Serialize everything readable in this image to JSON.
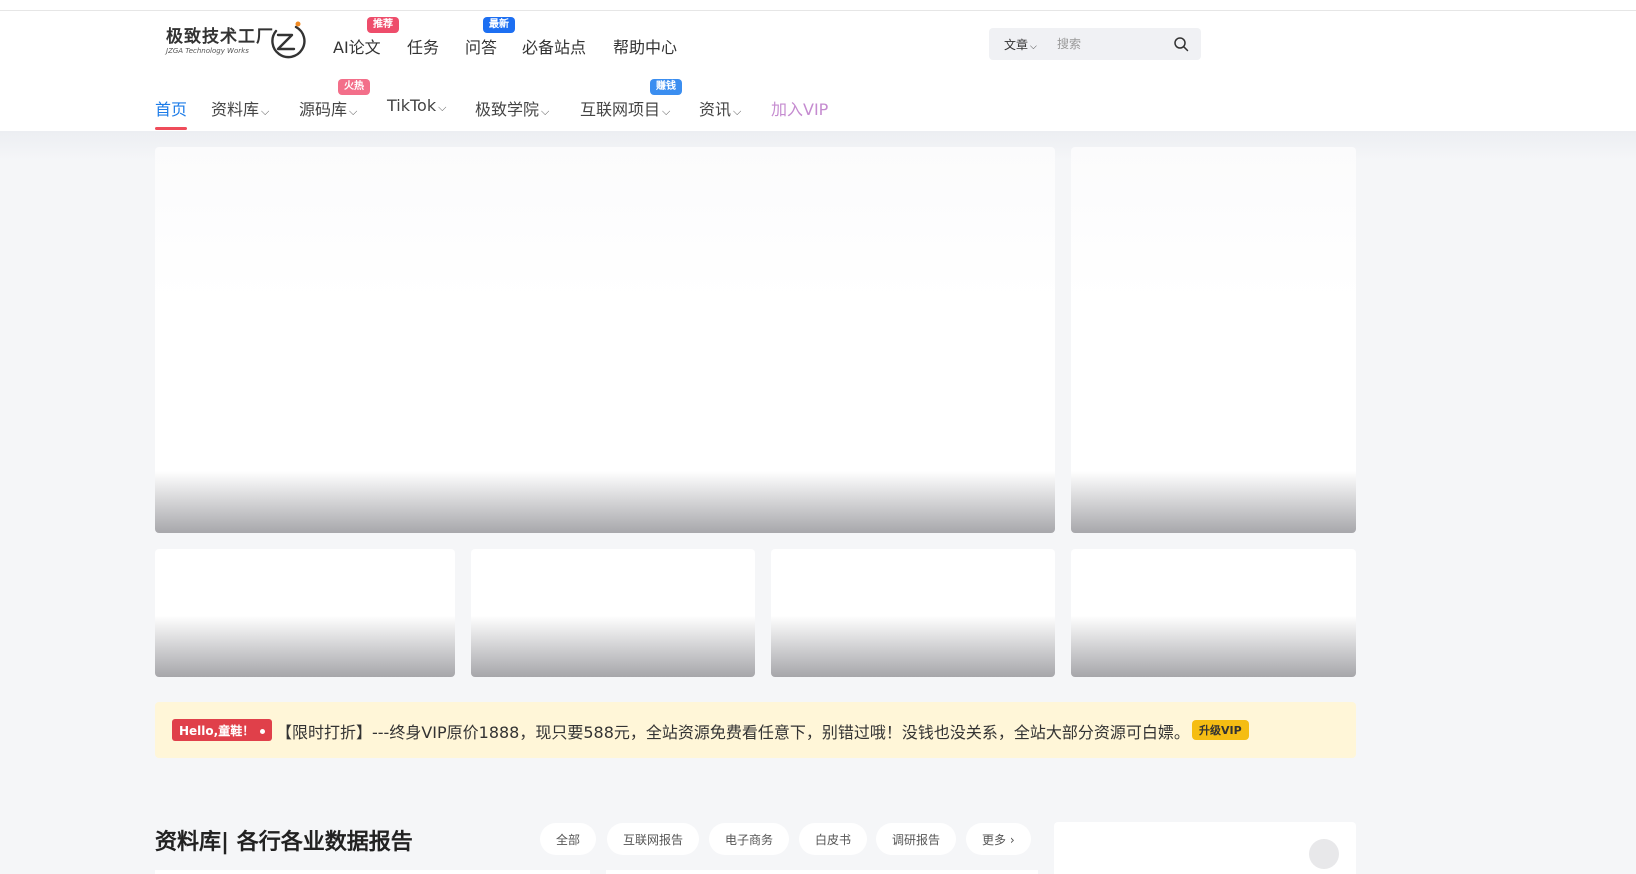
{
  "logo": {
    "title": "极致技术工厂",
    "subtitle": "JZGA Technology Works",
    "icon": "swirl-logo-icon"
  },
  "top_nav": [
    {
      "label": "AI论文",
      "badge": "推荐",
      "badge_color": "#ee4d6b"
    },
    {
      "label": "任务"
    },
    {
      "label": "问答",
      "badge": "最新",
      "badge_color": "#1d6ff2"
    },
    {
      "label": "必备站点"
    },
    {
      "label": "帮助中心"
    }
  ],
  "search": {
    "type_label": "文章",
    "placeholder": "搜索",
    "icon": "search-icon"
  },
  "main_nav": [
    {
      "label": "首页",
      "active": true
    },
    {
      "label": "资料库",
      "dropdown": true
    },
    {
      "label": "源码库",
      "dropdown": true,
      "badge": "火热",
      "badge_color": "#f36f8a"
    },
    {
      "label": "TikTok",
      "dropdown": true
    },
    {
      "label": "极致学院",
      "dropdown": true
    },
    {
      "label": "互联网项目",
      "dropdown": true,
      "badge": "赚钱",
      "badge_color": "#3b8ef0"
    },
    {
      "label": "资讯",
      "dropdown": true
    },
    {
      "label": "加入VIP",
      "color": "#c58bd0"
    }
  ],
  "notice": {
    "badge": "Hello,童鞋！",
    "text": "【限时打折】---终身VIP原价1888，现只要588元，全站资源免费看任意下，别错过哦！没钱也没关系，全站大部分资源可白嫖。",
    "button": "升级VIP"
  },
  "section": {
    "title": "资料库| 各行各业数据报告",
    "filters": [
      "全部",
      "互联网报告",
      "电子商务",
      "白皮书",
      "调研报告",
      "更多"
    ]
  },
  "colors": {
    "accent": "#1d7ce8",
    "active_underline": "#ef4c5a",
    "notice_bg": "#fff6d8",
    "upgrade": "#f5bd13"
  }
}
